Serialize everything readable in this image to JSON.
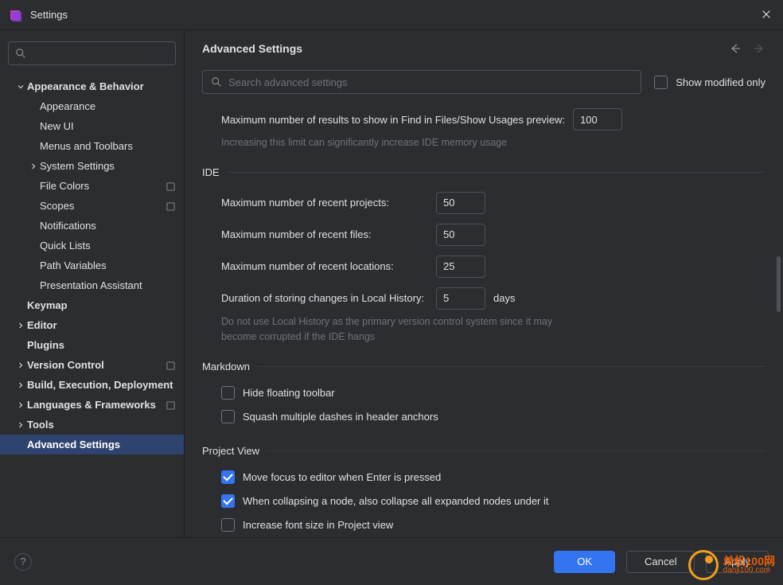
{
  "titlebar": {
    "title": "Settings"
  },
  "sidebar": {
    "search_value": "",
    "items": [
      {
        "label": "Appearance & Behavior",
        "chevron": "down",
        "depth": 0,
        "bold": true
      },
      {
        "label": "Appearance",
        "depth": 1
      },
      {
        "label": "New UI",
        "depth": 1
      },
      {
        "label": "Menus and Toolbars",
        "depth": 1
      },
      {
        "label": "System Settings",
        "chevron": "right",
        "depth": 1
      },
      {
        "label": "File Colors",
        "depth": 1,
        "consistent": true
      },
      {
        "label": "Scopes",
        "depth": 1,
        "consistent": true
      },
      {
        "label": "Notifications",
        "depth": 1
      },
      {
        "label": "Quick Lists",
        "depth": 1
      },
      {
        "label": "Path Variables",
        "depth": 1
      },
      {
        "label": "Presentation Assistant",
        "depth": 1
      },
      {
        "label": "Keymap",
        "depth": 0,
        "bold": true
      },
      {
        "label": "Editor",
        "chevron": "right",
        "depth": 0,
        "bold": true
      },
      {
        "label": "Plugins",
        "depth": 0,
        "bold": true
      },
      {
        "label": "Version Control",
        "chevron": "right",
        "depth": 0,
        "bold": true,
        "consistent": true
      },
      {
        "label": "Build, Execution, Deployment",
        "chevron": "right",
        "depth": 0,
        "bold": true
      },
      {
        "label": "Languages & Frameworks",
        "chevron": "right",
        "depth": 0,
        "bold": true,
        "consistent": true
      },
      {
        "label": "Tools",
        "chevron": "right",
        "depth": 0,
        "bold": true
      },
      {
        "label": "Advanced Settings",
        "depth": 0,
        "bold": true,
        "selected": true
      }
    ]
  },
  "main": {
    "title": "Advanced Settings",
    "search_placeholder": "Search advanced settings",
    "show_modified_label": "Show modified only",
    "find_results_label": "Maximum number of results to show in Find in Files/Show Usages preview:",
    "find_results_value": "100",
    "find_results_hint": "Increasing this limit can significantly increase IDE memory usage",
    "sections": {
      "ide": {
        "title": "IDE",
        "recent_projects_label": "Maximum number of recent projects:",
        "recent_projects_value": "50",
        "recent_files_label": "Maximum number of recent files:",
        "recent_files_value": "50",
        "recent_locations_label": "Maximum number of recent locations:",
        "recent_locations_value": "25",
        "local_history_label": "Duration of storing changes in Local History:",
        "local_history_value": "5",
        "local_history_suffix": "days",
        "local_history_hint": "Do not use Local History as the primary version control system since it may become corrupted if the IDE hangs"
      },
      "markdown": {
        "title": "Markdown",
        "hide_toolbar_label": "Hide floating toolbar",
        "squash_dashes_label": "Squash multiple dashes in header anchors"
      },
      "project_view": {
        "title": "Project View",
        "move_focus_label": "Move focus to editor when Enter is pressed",
        "collapse_label": "When collapsing a node, also collapse all expanded nodes under it",
        "increase_font_label": "Increase font size in Project view"
      }
    }
  },
  "footer": {
    "ok": "OK",
    "cancel": "Cancel",
    "apply": "Apply"
  },
  "watermark": {
    "cn": "单机100网",
    "en": "danji100.com"
  }
}
